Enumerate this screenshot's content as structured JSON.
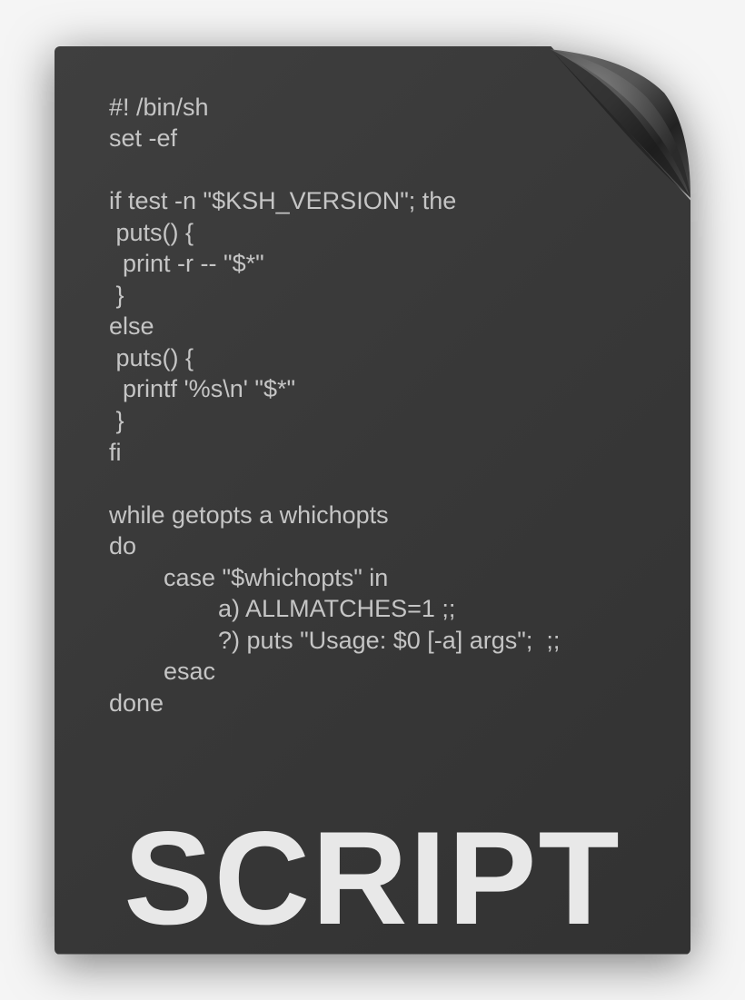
{
  "icon": {
    "label": "SCRIPT",
    "code_lines": [
      "#! /bin/sh",
      "set -ef",
      "",
      "if test -n \"$KSH_VERSION\"; the",
      " puts() {",
      "  print -r -- \"$*\"",
      " }",
      "else",
      " puts() {",
      "  printf '%s\\n' \"$*\"",
      " }",
      "fi",
      "",
      "while getopts a whichopts",
      "do",
      "        case \"$whichopts\" in",
      "                a) ALLMATCHES=1 ;;",
      "                ?) puts \"Usage: $0 [-a] args\";  ;;",
      "        esac",
      "done"
    ]
  }
}
